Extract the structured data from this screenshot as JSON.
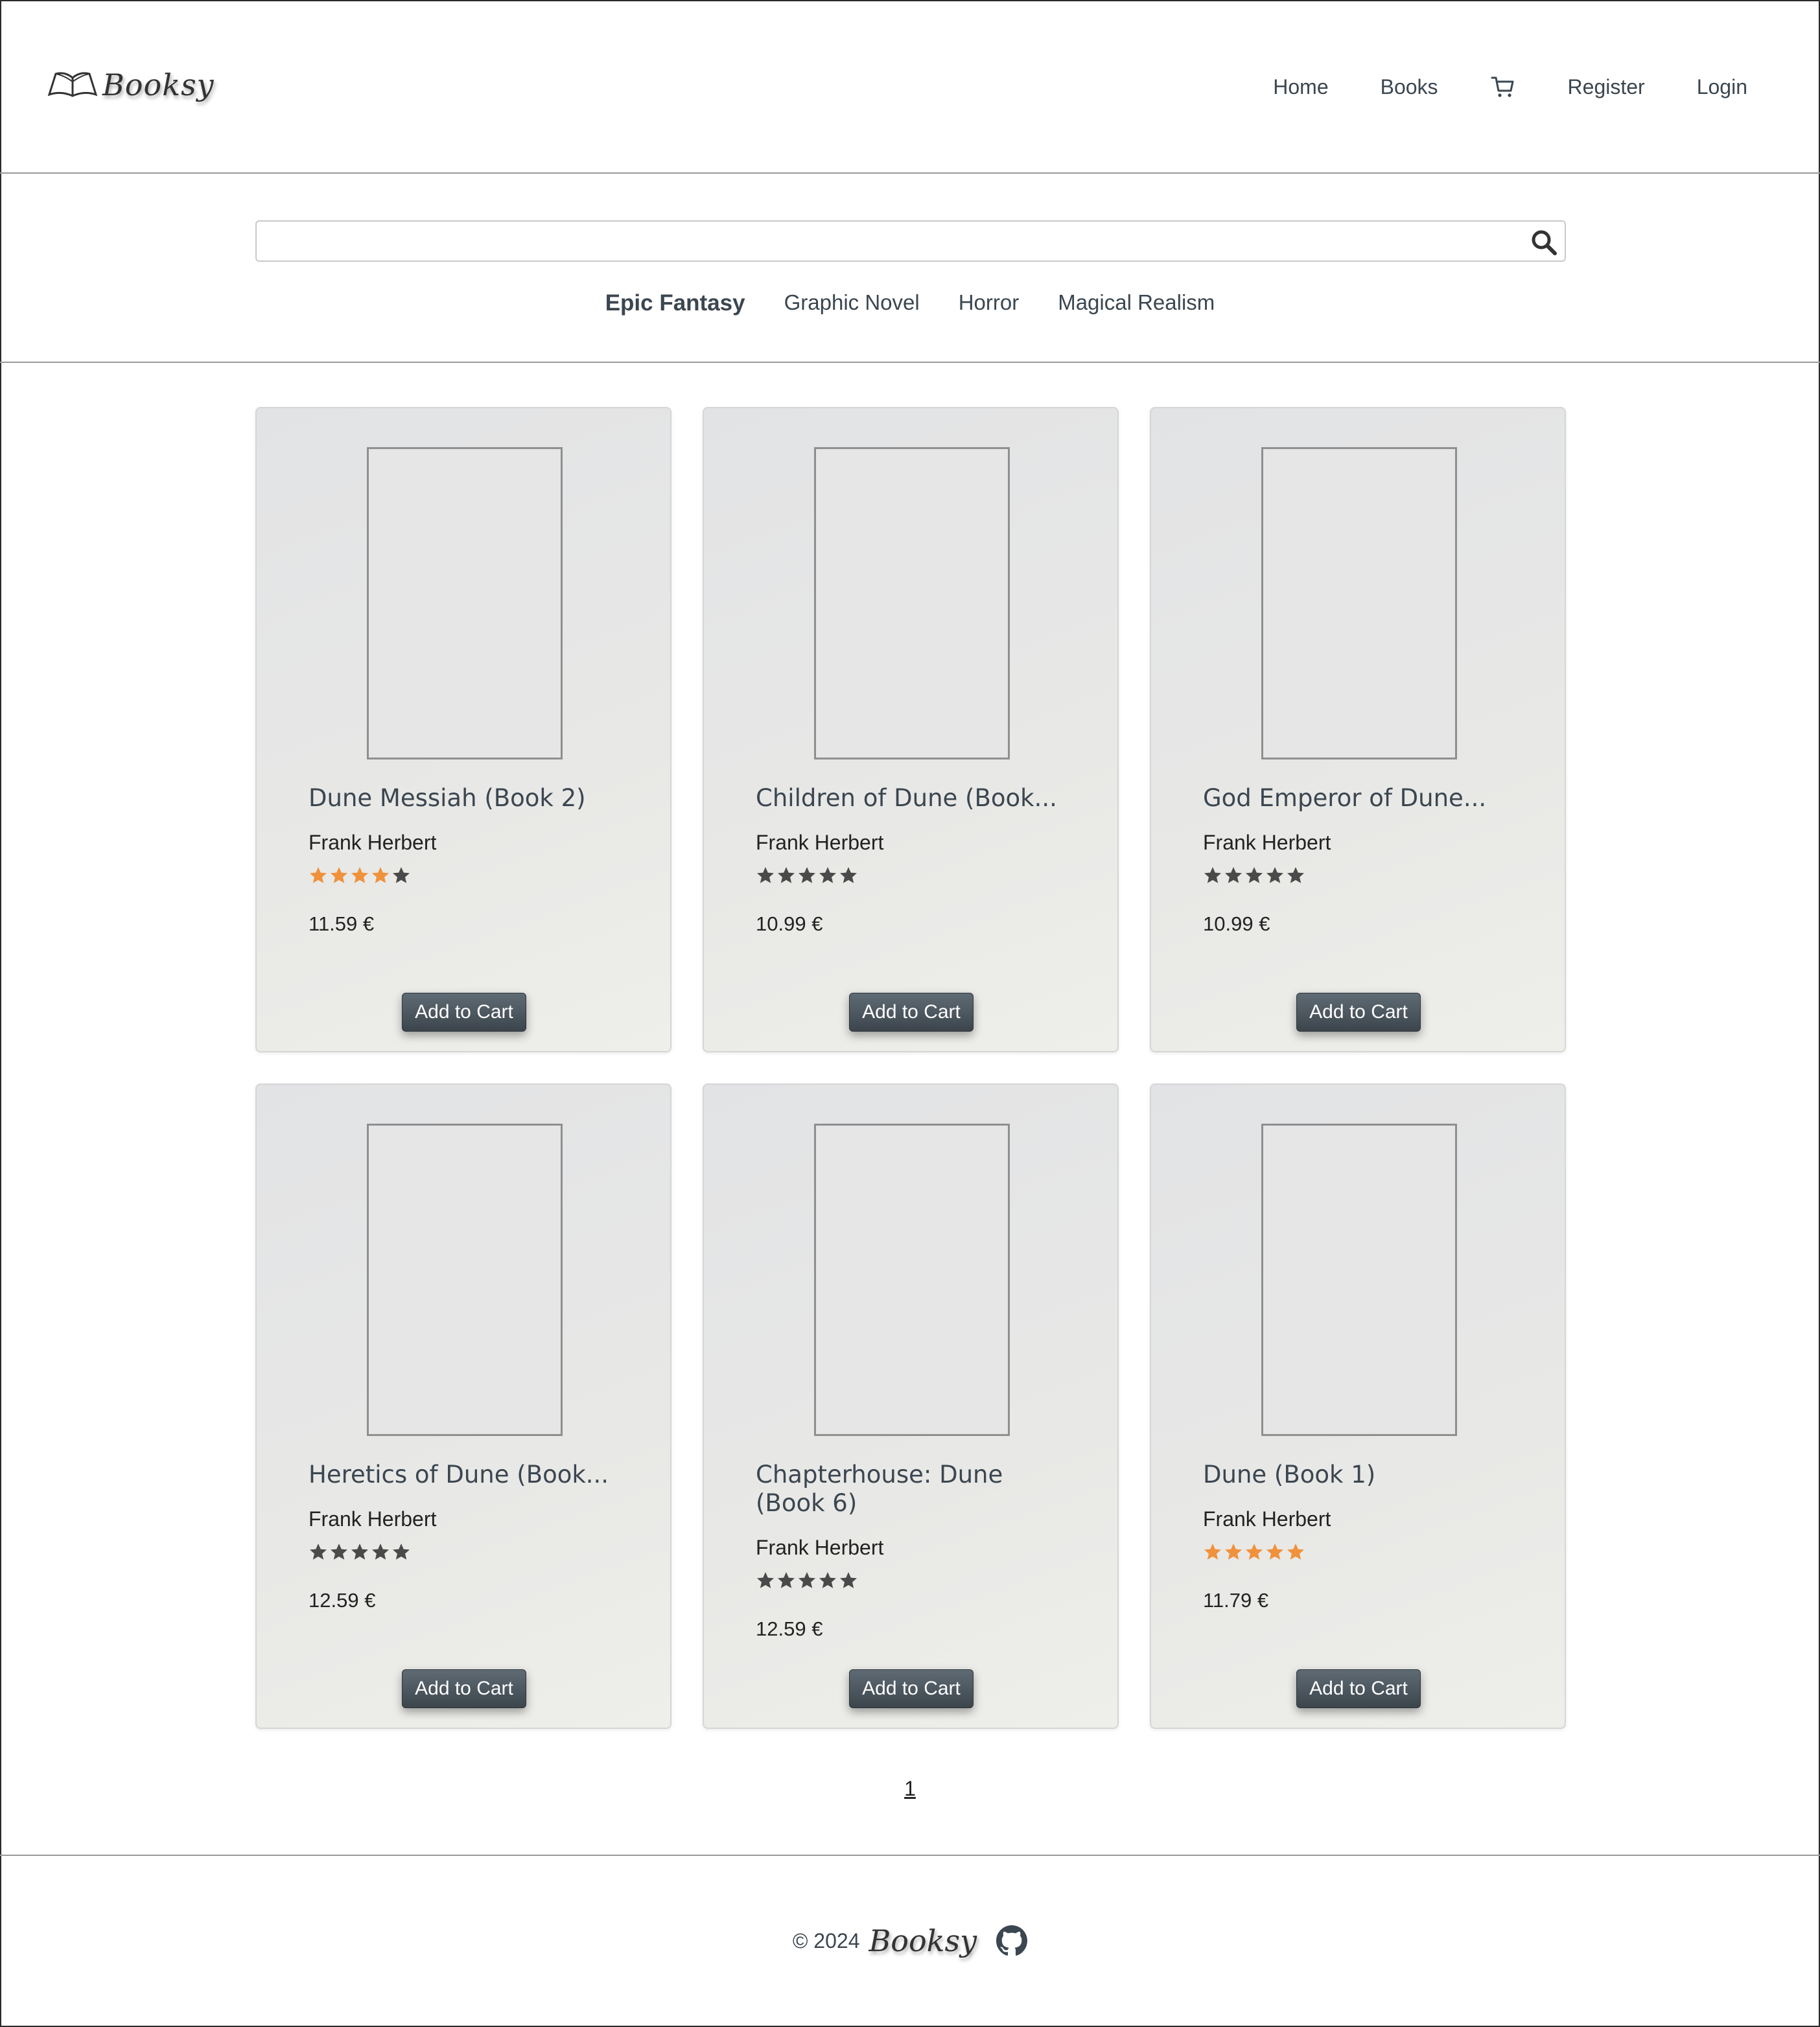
{
  "brand": {
    "name": "Booksy"
  },
  "nav": {
    "home": "Home",
    "books": "Books",
    "cart_icon": "cart-icon",
    "register": "Register",
    "login": "Login"
  },
  "search": {
    "placeholder": "",
    "value": "",
    "icon": "search-icon"
  },
  "genres": [
    "Epic Fantasy",
    "Graphic Novel",
    "Horror",
    "Magical Realism"
  ],
  "active_genre": "Epic Fantasy",
  "colors": {
    "star_active": "#f0913c",
    "star_inactive": "#4a4a4a",
    "button": "#4a545b"
  },
  "books": [
    {
      "title": "Dune Messiah (Book 2)",
      "author": "Frank Herbert",
      "rating": 4,
      "highlighted": true,
      "price": "11.59 €",
      "button": "Add to Cart"
    },
    {
      "title": "Children of Dune (Book...",
      "author": "Frank Herbert",
      "rating": 5,
      "highlighted": false,
      "price": "10.99 €",
      "button": "Add to Cart"
    },
    {
      "title": "God Emperor of Dune...",
      "author": "Frank Herbert",
      "rating": 5,
      "highlighted": false,
      "price": "10.99 €",
      "button": "Add to Cart"
    },
    {
      "title": "Heretics of Dune (Book...",
      "author": "Frank Herbert",
      "rating": 5,
      "highlighted": false,
      "price": "12.59 €",
      "button": "Add to Cart"
    },
    {
      "title": "Chapterhouse: Dune (Book 6)",
      "author": "Frank Herbert",
      "rating": 5,
      "highlighted": false,
      "price": "12.59 €",
      "button": "Add to Cart"
    },
    {
      "title": "Dune (Book 1)",
      "author": "Frank Herbert",
      "rating": 5,
      "highlighted": true,
      "price": "11.79 €",
      "button": "Add to Cart"
    }
  ],
  "pagination": {
    "current": "1"
  },
  "footer": {
    "copyright": "© 2024",
    "brand": "Booksy",
    "icon": "github-icon"
  }
}
